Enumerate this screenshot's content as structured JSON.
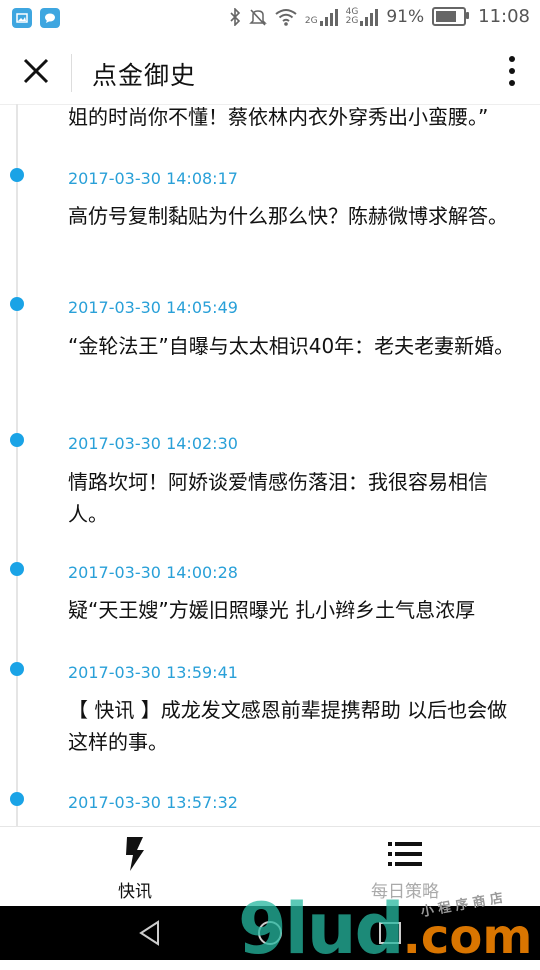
{
  "status_bar": {
    "net_top": "2G",
    "net2_top": "4G",
    "net2_bottom": "2G",
    "battery": "91%",
    "battery_level": 0.91,
    "time": "11:08",
    "icons": [
      "gallery-app-icon",
      "message-app-icon",
      "bluetooth-icon",
      "mute-icon",
      "wifi-icon",
      "signal-icon",
      "battery-icon"
    ]
  },
  "header": {
    "title": "点金御史",
    "close_icon": "close-icon",
    "more_icon": "more-vertical-icon"
  },
  "feed": {
    "partial_top": "姐的时尚你不懂！蔡依林内衣外穿秀出小蛮腰。”",
    "items": [
      {
        "time": "2017-03-30 14:08:17",
        "title": "高仿号复制黏贴为什么那么快？陈赫微博求解答。"
      },
      {
        "time": "2017-03-30 14:05:49",
        "title": "“金轮法王”自曝与太太相识40年：老夫老妻新婚。"
      },
      {
        "time": "2017-03-30 14:02:30",
        "title": "情路坎坷！阿娇谈爱情感伤落泪：我很容易相信人。"
      },
      {
        "time": "2017-03-30 14:00:28",
        "title": "疑“天王嫂”方媛旧照曝光 扎小辫乡土气息浓厚"
      },
      {
        "time": "2017-03-30 13:59:41",
        "title": "【 快讯 】成龙发文感恩前辈提携帮助 以后也会做这样的事。"
      },
      {
        "time": "2017-03-30 13:57:32",
        "title": ""
      }
    ],
    "accent_color": "#1aa3e6"
  },
  "tabs": [
    {
      "label": "快讯",
      "icon": "lightning-icon",
      "active": true
    },
    {
      "label": "每日策略",
      "icon": "list-icon",
      "active": false
    }
  ],
  "watermark": {
    "main": "9lud",
    "dot": ".com",
    "sub": "小 程 序 商 店"
  }
}
